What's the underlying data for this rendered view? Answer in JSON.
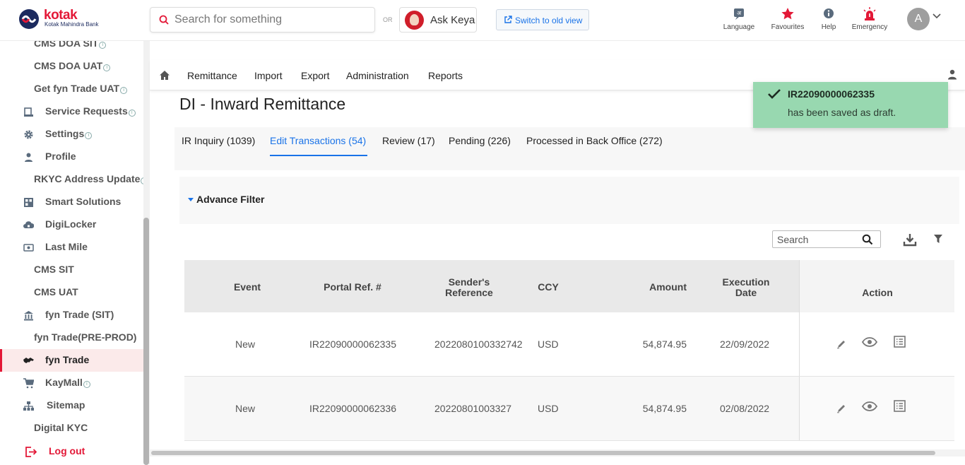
{
  "header": {
    "logo_name": "kotak",
    "logo_sub": "Kotak Mahindra Bank",
    "search_placeholder": "Search for something",
    "or_label": "OR",
    "ask_keya": "Ask Keya",
    "switch_old_view": "Switch to old view",
    "language": "Language",
    "favourites": "Favourites",
    "help": "Help",
    "emergency": "Emergency",
    "user_initial": "A",
    "accent_color": "#e31837",
    "link_color": "#1a73e8"
  },
  "sidebar": {
    "items": [
      {
        "label": "CMS DOA SIT",
        "icon": "",
        "info": true
      },
      {
        "label": "CMS DOA UAT",
        "icon": "",
        "info": true
      },
      {
        "label": "Get fyn Trade UAT",
        "icon": "",
        "info": true
      },
      {
        "label": "Service Requests",
        "icon": "service-request-icon",
        "info": true
      },
      {
        "label": "Settings",
        "icon": "gear-icon",
        "info": true
      },
      {
        "label": "Profile",
        "icon": "person-icon",
        "info": false
      },
      {
        "label": "RKYC Address Update",
        "icon": "",
        "info": true
      },
      {
        "label": "Smart Solutions",
        "icon": "grid-icon",
        "info": false
      },
      {
        "label": "DigiLocker",
        "icon": "cloud-lock-icon",
        "info": false
      },
      {
        "label": "Last Mile",
        "icon": "cash-icon",
        "info": false
      },
      {
        "label": "CMS SIT",
        "icon": "",
        "info": false
      },
      {
        "label": "CMS UAT",
        "icon": "",
        "info": false
      },
      {
        "label": "fyn Trade (SIT)",
        "icon": "bank-icon",
        "info": false
      },
      {
        "label": "fyn Trade(PRE-PROD)",
        "icon": "",
        "info": false
      },
      {
        "label": "fyn Trade",
        "icon": "handshake-icon",
        "info": false,
        "active": true
      },
      {
        "label": "KayMall",
        "icon": "cart-icon",
        "info": true
      },
      {
        "label": "Sitemap",
        "icon": "sitemap-icon",
        "info": false
      },
      {
        "label": "Digital KYC",
        "icon": "",
        "info": false
      }
    ],
    "logout": "Log out"
  },
  "menu": {
    "items": [
      "Remittance",
      "Import",
      "Export",
      "Administration",
      "Reports"
    ]
  },
  "page": {
    "title": "DI - Inward Remittance",
    "tabs": [
      {
        "label": "IR Inquiry (1039)",
        "active": false
      },
      {
        "label": "Edit Transactions (54)",
        "active": true
      },
      {
        "label": "Review (17)",
        "active": false
      },
      {
        "label": "Pending (226)",
        "active": false
      },
      {
        "label": "Processed in Back Office (272)",
        "active": false
      }
    ],
    "advance_filter": "Advance Filter",
    "table_search_placeholder": "Search"
  },
  "table": {
    "columns": [
      "Event",
      "Portal Ref. #",
      "Sender's Reference",
      "CCY",
      "Amount",
      "Execution Date",
      "Action"
    ],
    "rows": [
      {
        "event": "New",
        "portal_ref": "IR22090000062335",
        "sender_ref": "2022080100332742",
        "ccy": "USD",
        "amount": "54,874.95",
        "exec_date": "22/09/2022"
      },
      {
        "event": "New",
        "portal_ref": "IR22090000062336",
        "sender_ref": "20220801003327",
        "ccy": "USD",
        "amount": "54,874.95",
        "exec_date": "02/08/2022"
      }
    ]
  },
  "toast": {
    "ref": "IR22090000062335",
    "message": "has been saved as draft.",
    "color": "#98d8b0"
  }
}
